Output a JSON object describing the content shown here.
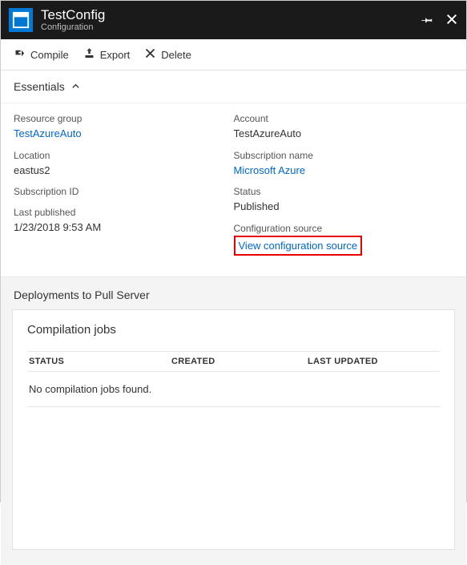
{
  "header": {
    "title": "TestConfig",
    "subtitle": "Configuration"
  },
  "toolbar": {
    "compile": "Compile",
    "export": "Export",
    "delete": "Delete"
  },
  "essentials": {
    "toggle_label": "Essentials",
    "left": {
      "resource_group_label": "Resource group",
      "resource_group_value": "TestAzureAuto",
      "location_label": "Location",
      "location_value": "eastus2",
      "subscription_id_label": "Subscription ID",
      "last_published_label": "Last published",
      "last_published_value": "1/23/2018 9:53 AM"
    },
    "right": {
      "account_label": "Account",
      "account_value": "TestAzureAuto",
      "subscription_name_label": "Subscription name",
      "subscription_name_value": "Microsoft Azure",
      "status_label": "Status",
      "status_value": "Published",
      "config_source_label": "Configuration source",
      "config_source_value": "View configuration source"
    }
  },
  "deployments": {
    "section_title": "Deployments to Pull Server",
    "card_title": "Compilation jobs",
    "columns": {
      "status": "STATUS",
      "created": "CREATED",
      "updated": "LAST UPDATED"
    },
    "empty_message": "No compilation jobs found."
  }
}
